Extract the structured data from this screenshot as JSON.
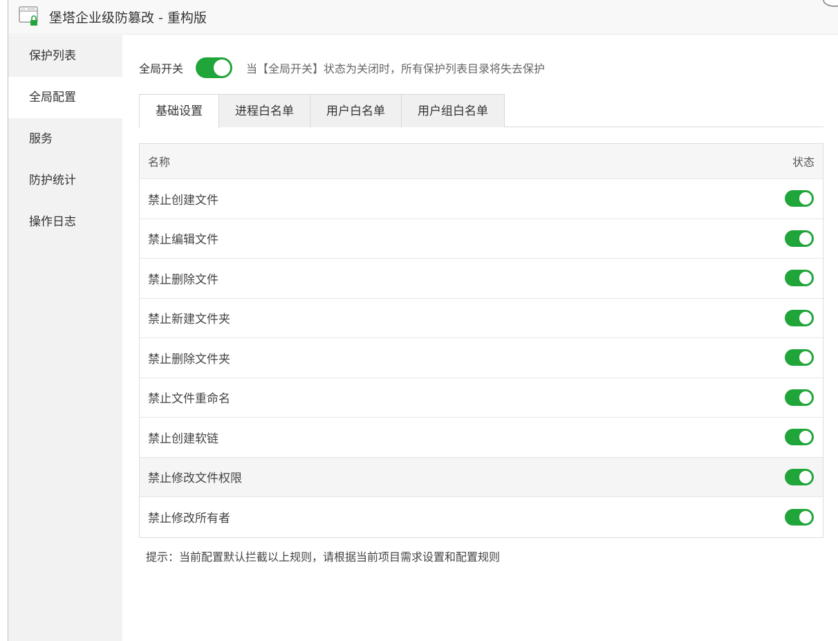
{
  "window": {
    "title": "堡塔企业级防篡改 - 重构版"
  },
  "sidebar": {
    "items": [
      {
        "label": "保护列表",
        "active": false
      },
      {
        "label": "全局配置",
        "active": true
      },
      {
        "label": "服务",
        "active": false
      },
      {
        "label": "防护统计",
        "active": false
      },
      {
        "label": "操作日志",
        "active": false
      }
    ]
  },
  "global": {
    "label": "全局开关",
    "enabled": true,
    "hint": "当【全局开关】状态为关闭时，所有保护列表目录将失去保护"
  },
  "tabs": [
    {
      "label": "基础设置",
      "active": true
    },
    {
      "label": "进程白名单",
      "active": false
    },
    {
      "label": "用户白名单",
      "active": false
    },
    {
      "label": "用户组白名单",
      "active": false
    }
  ],
  "table": {
    "columns": [
      "名称",
      "状态"
    ],
    "rows": [
      {
        "name": "禁止创建文件",
        "enabled": true
      },
      {
        "name": "禁止编辑文件",
        "enabled": true
      },
      {
        "name": "禁止删除文件",
        "enabled": true
      },
      {
        "name": "禁止新建文件夹",
        "enabled": true
      },
      {
        "name": "禁止删除文件夹",
        "enabled": true
      },
      {
        "name": "禁止文件重命名",
        "enabled": true
      },
      {
        "name": "禁止创建软链",
        "enabled": true
      },
      {
        "name": "禁止修改文件权限",
        "enabled": true
      },
      {
        "name": "禁止修改所有者",
        "enabled": true
      }
    ]
  },
  "tip": "提示：当前配置默认拦截以上规则，请根据当前项目需求设置和配置规则",
  "colors": {
    "accent": "#20a53a",
    "sidebar_bg": "#f2f2f2"
  }
}
